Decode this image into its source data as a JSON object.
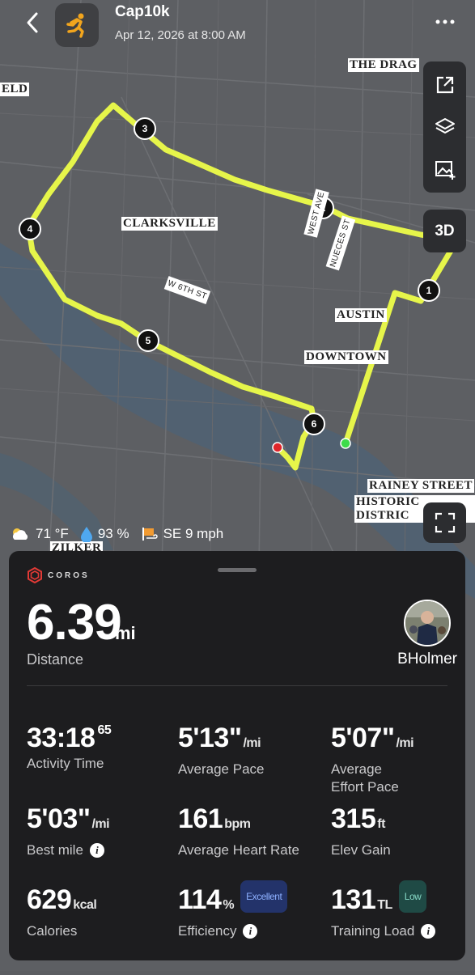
{
  "header": {
    "title": "Cap10k",
    "date": "Apr 12, 2026 at 8:00 AM"
  },
  "map": {
    "labels": {
      "the_drag": "THE DRAG",
      "eld": "ELD",
      "clarksville": "CLARKSVILLE",
      "austin": "AUSTIN",
      "downtown": "DOWNTOWN",
      "rainey_1": "RAINEY STREET",
      "rainey_2": "HISTORIC DISTRIC",
      "zilker": "ZILKER",
      "w6th": "W 6TH ST",
      "nueces": "NUECES ST",
      "west_ave": "WEST AVE"
    },
    "mile_markers": [
      "1",
      "2",
      "3",
      "4",
      "5",
      "6"
    ],
    "three_d_label": "3D",
    "route_color": "#e6f54a",
    "start_color": "#3ddc4a",
    "end_color": "#e0262b"
  },
  "weather": {
    "temp": "71 °F",
    "humidity": "93 %",
    "wind": "SE 9 mph"
  },
  "panel": {
    "brand": "COROS",
    "distance_value": "6.39",
    "distance_unit": "mi",
    "distance_label": "Distance",
    "username": "BHolmer",
    "stats": {
      "activity_time": {
        "value": "33:18",
        "sup": "65",
        "label": "Activity Time"
      },
      "avg_pace": {
        "value": "5'13\"",
        "unit": "/mi",
        "label": "Average Pace"
      },
      "avg_effort_pace": {
        "value": "5'07\"",
        "unit": "/mi",
        "label_1": "Average",
        "label_2": "Effort Pace"
      },
      "best_mile": {
        "value": "5'03\"",
        "unit": "/mi",
        "label": "Best mile"
      },
      "avg_hr": {
        "value": "161",
        "unit": "bpm",
        "label": "Average Heart Rate"
      },
      "elev_gain": {
        "value": "315",
        "unit": "ft",
        "label": "Elev Gain"
      },
      "calories": {
        "value": "629",
        "unit": "kcal",
        "label": "Calories"
      },
      "efficiency": {
        "value": "114",
        "unit": "%",
        "badge": "Excellent",
        "label": "Efficiency"
      },
      "training_load": {
        "value": "131",
        "unit": "TL",
        "badge": "Low",
        "label": "Training Load"
      }
    }
  }
}
